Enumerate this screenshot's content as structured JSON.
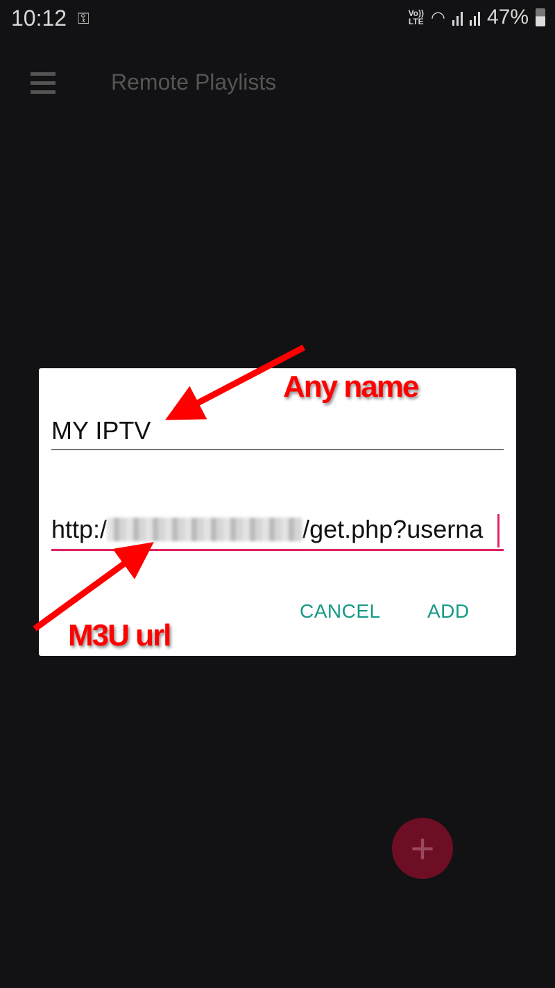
{
  "status_bar": {
    "time": "10:12",
    "key_icon": "vpn-key-icon",
    "volte": "Vo)) LTE",
    "battery": "47%"
  },
  "app_bar": {
    "menu_icon": "hamburger-menu-icon",
    "title": "Remote Playlists"
  },
  "dialog": {
    "name_field": {
      "value": "MY IPTV"
    },
    "url_field": {
      "value_prefix": "http:/",
      "value_suffix": "/get.php?userna"
    },
    "cancel_label": "CANCEL",
    "add_label": "ADD",
    "accent_color": "#149987",
    "focus_color": "#e0245e"
  },
  "annotations": {
    "name_hint": "Any name",
    "url_hint": "M3U url"
  },
  "fab": {
    "icon": "plus-icon",
    "label": "+"
  }
}
